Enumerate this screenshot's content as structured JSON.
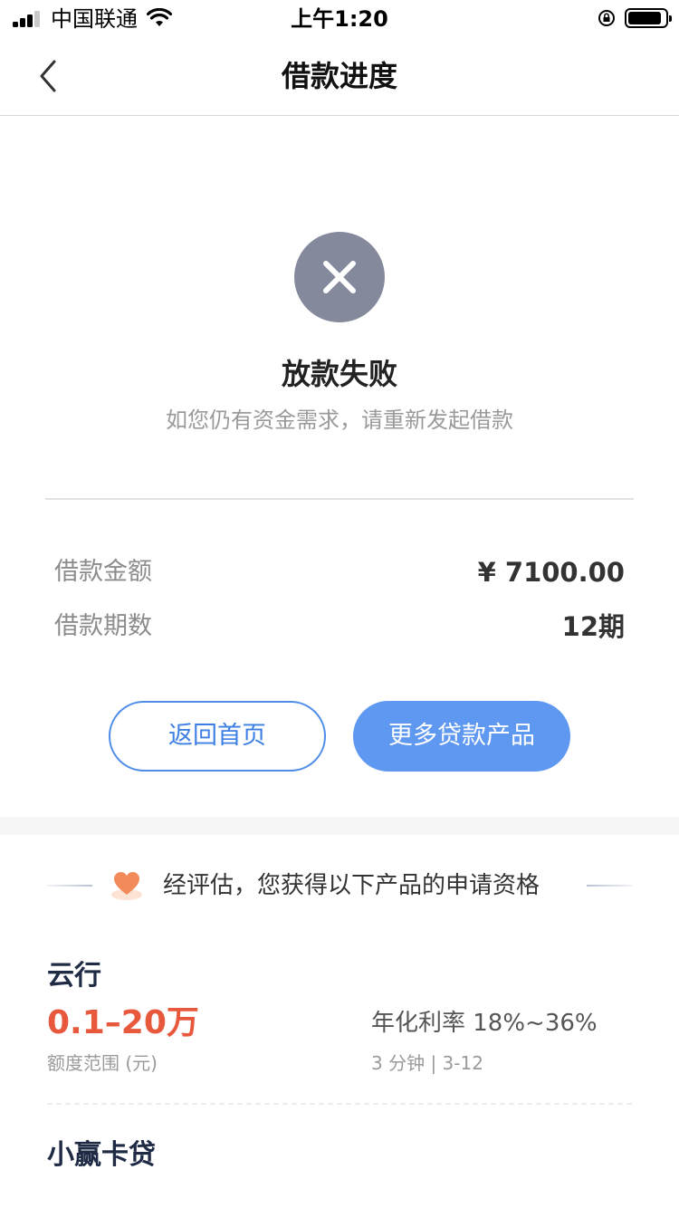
{
  "status_bar": {
    "carrier": "中国联通",
    "time": "上午1:20"
  },
  "nav": {
    "title": "借款进度"
  },
  "result": {
    "title": "放款失败",
    "subtitle": "如您仍有资金需求，请重新发起借款",
    "icon": "close-circle-icon",
    "icon_color": "#848a9c"
  },
  "loan_info": {
    "amount_label": "借款金额",
    "amount_value": "¥ 7100.00",
    "period_label": "借款期数",
    "period_value": "12期"
  },
  "buttons": {
    "home_label": "返回首页",
    "more_label": "更多贷款产品",
    "primary_color": "#5e98f0"
  },
  "qualification": {
    "text": "经评估，您获得以下产品的申请资格"
  },
  "products": [
    {
      "name": "云行",
      "range": "0.1–20万",
      "range_label": "额度范围 (元)",
      "rate": "年化利率 18%~36%",
      "meta": "3 分钟 | 3-12"
    },
    {
      "name": "小赢卡贷"
    }
  ]
}
